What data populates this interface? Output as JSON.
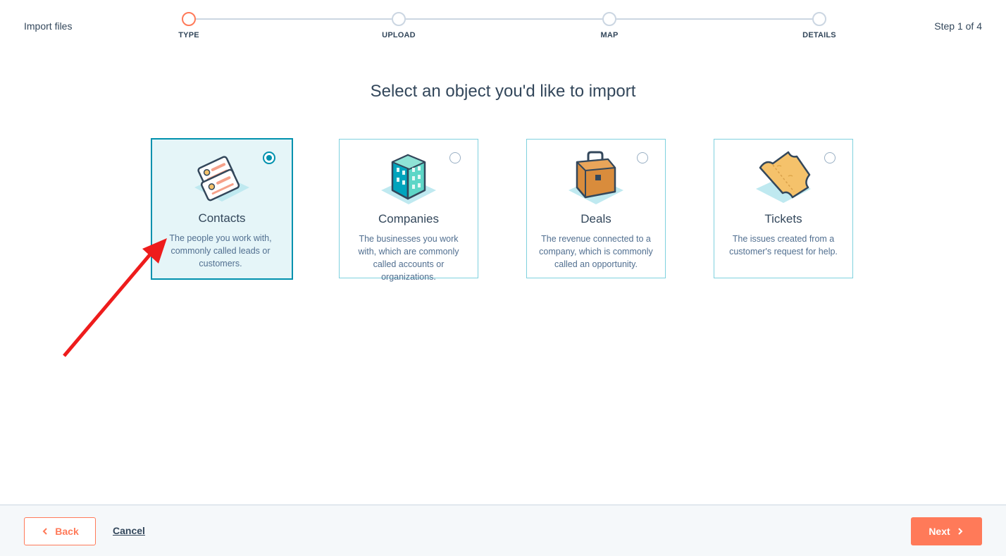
{
  "header": {
    "title": "Import files",
    "step_count": "Step 1 of 4"
  },
  "stepper": {
    "steps": [
      {
        "label": "TYPE",
        "active": true
      },
      {
        "label": "UPLOAD",
        "active": false
      },
      {
        "label": "MAP",
        "active": false
      },
      {
        "label": "DETAILS",
        "active": false
      }
    ]
  },
  "main": {
    "title": "Select an object you'd like to import",
    "cards": [
      {
        "title": "Contacts",
        "description": "The people you work with, commonly called leads or customers.",
        "selected": true,
        "icon": "contact-cards-icon"
      },
      {
        "title": "Companies",
        "description": "The businesses you work with, which are commonly called accounts or organizations.",
        "selected": false,
        "icon": "building-icon"
      },
      {
        "title": "Deals",
        "description": "The revenue connected to a company, which is commonly called an opportunity.",
        "selected": false,
        "icon": "briefcase-icon"
      },
      {
        "title": "Tickets",
        "description": "The issues created from a customer's request for help.",
        "selected": false,
        "icon": "ticket-icon"
      }
    ]
  },
  "footer": {
    "back_label": "Back",
    "cancel_label": "Cancel",
    "next_label": "Next"
  },
  "colors": {
    "accent": "#ff7a59",
    "selected_border": "#0091ae",
    "selected_bg": "#e5f5f8",
    "card_border": "#7fd1de",
    "annotation_arrow": "#ee1c1c"
  }
}
